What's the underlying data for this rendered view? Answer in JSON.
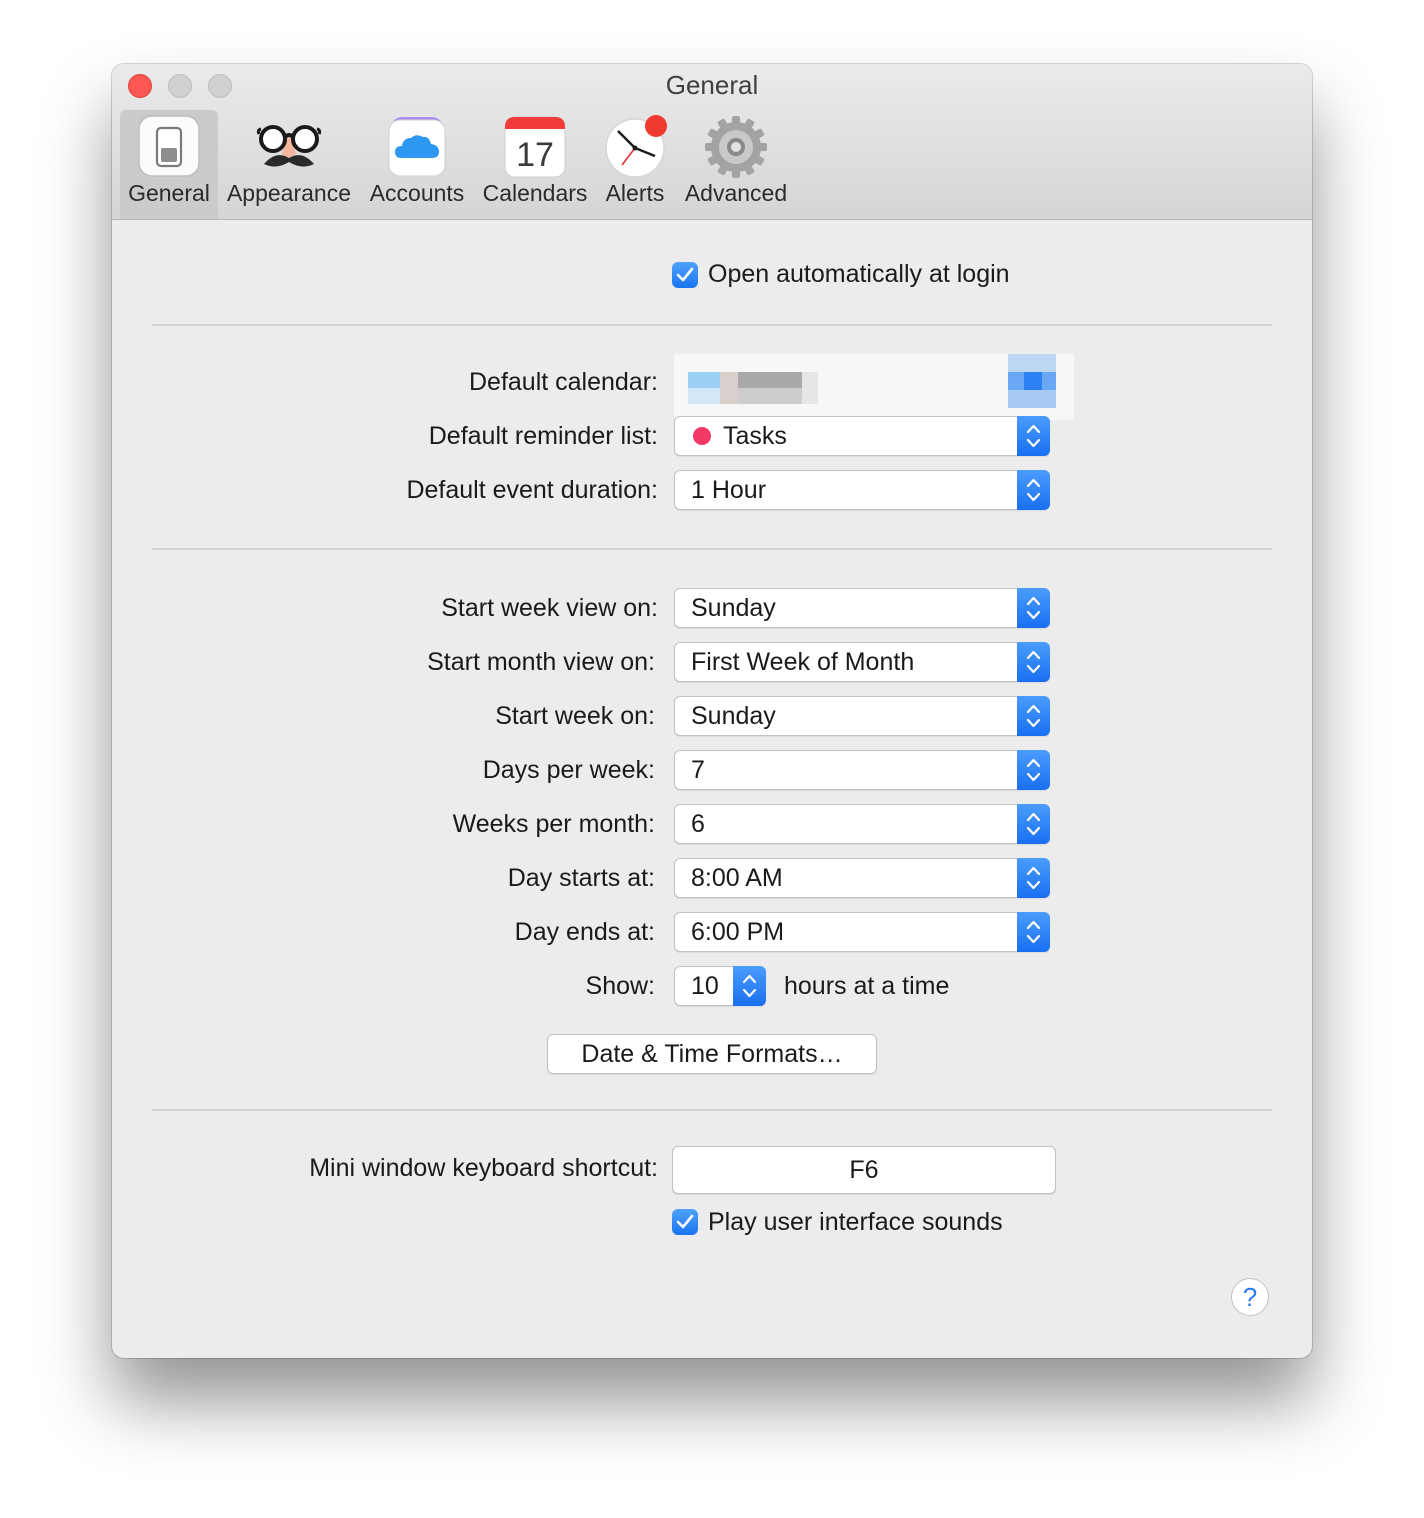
{
  "window": {
    "title": "General"
  },
  "toolbar": {
    "tabs": [
      {
        "label": "General",
        "icon": "general-switch-icon",
        "active": true
      },
      {
        "label": "Appearance",
        "icon": "disguise-glasses-icon"
      },
      {
        "label": "Accounts",
        "icon": "cloud-icon"
      },
      {
        "label": "Calendars",
        "icon": "calendar-icon",
        "day": "17"
      },
      {
        "label": "Alerts",
        "icon": "clock-alert-icon"
      },
      {
        "label": "Advanced",
        "icon": "gear-icon"
      }
    ]
  },
  "login": {
    "label": "Open automatically at login",
    "checked": true
  },
  "defaults": {
    "calendar_label": "Default calendar:",
    "reminder_label": "Default reminder list:",
    "reminder_value": "Tasks",
    "reminder_color": "#f43866",
    "duration_label": "Default event duration:",
    "duration_value": "1 Hour"
  },
  "views": {
    "week_view_label": "Start week view on:",
    "week_view_value": "Sunday",
    "month_view_label": "Start month view on:",
    "month_view_value": "First Week of Month",
    "start_week_label": "Start week on:",
    "start_week_value": "Sunday",
    "days_label": "Days per week:",
    "days_value": "7",
    "weeks_label": "Weeks per month:",
    "weeks_value": "6",
    "day_start_label": "Day starts at:",
    "day_start_value": "8:00 AM",
    "day_end_label": "Day ends at:",
    "day_end_value": "6:00 PM",
    "show_label": "Show:",
    "show_value": "10",
    "show_suffix": "hours at a time",
    "formats_button": "Date & Time Formats…"
  },
  "mini": {
    "shortcut_label": "Mini window keyboard shortcut:",
    "shortcut_value": "F6",
    "sounds_label": "Play user interface sounds",
    "sounds_checked": true
  },
  "help": {
    "glyph": "?"
  },
  "colors": {
    "accent": "#2b7cf3",
    "close": "#fc5753"
  }
}
